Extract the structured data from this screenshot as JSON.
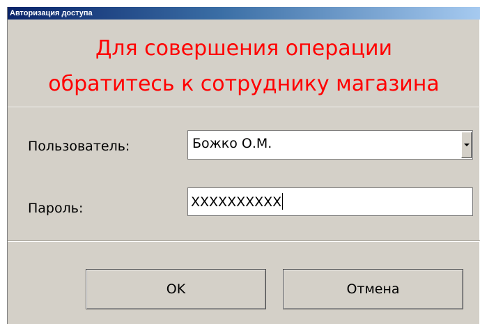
{
  "window": {
    "title": "Авторизация доступа"
  },
  "message": {
    "line1": "Для совершения операции",
    "line2": "обратитесь к сотруднику магазина"
  },
  "form": {
    "user_label": "Пользователь:",
    "user_value": "Божко О.М.",
    "password_label": "Пароль:",
    "password_value": "XXXXXXXXXX"
  },
  "buttons": {
    "ok_label": "OK",
    "cancel_label": "Отмена"
  },
  "colors": {
    "message": "#ff0000",
    "dialog_background": "#d4d0c8",
    "titlebar_start": "#0a246a",
    "titlebar_end": "#a6caf0"
  },
  "icons": {
    "combo_arrow": "chevron-down-icon"
  }
}
